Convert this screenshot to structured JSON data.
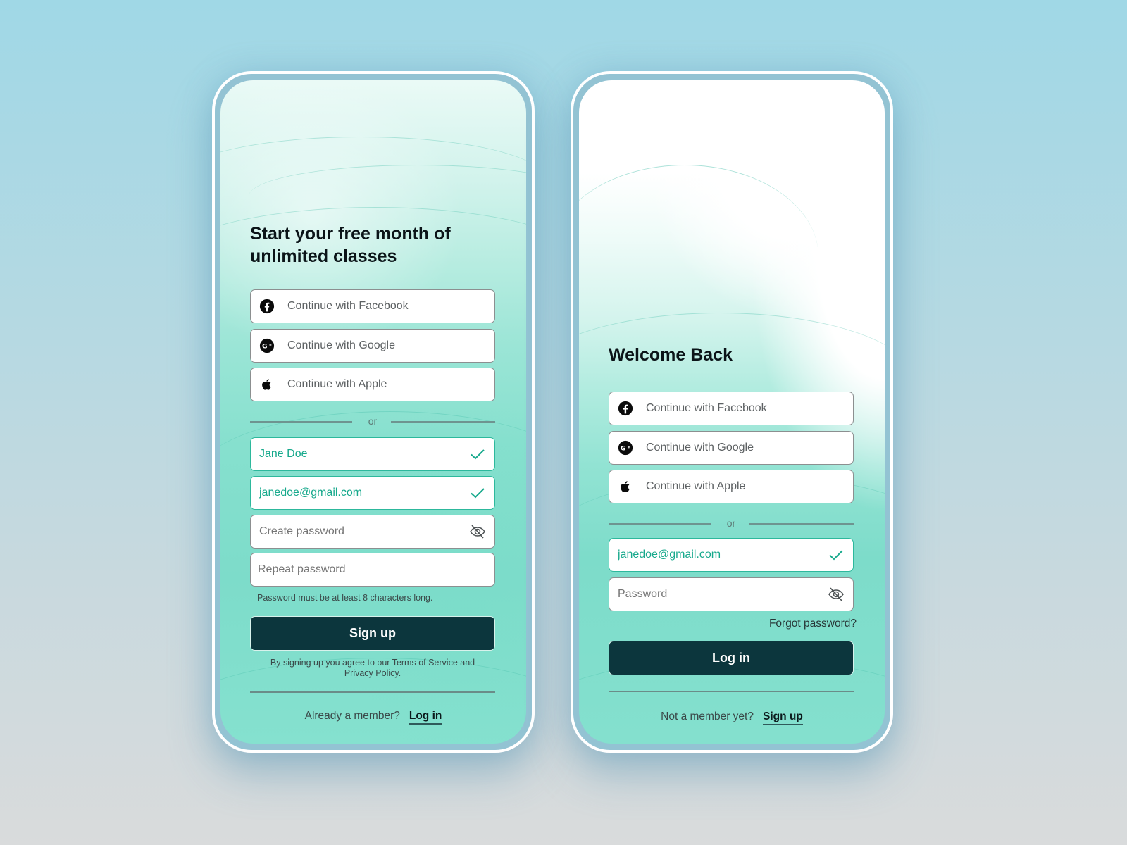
{
  "colors": {
    "accent_teal": "#17a98c",
    "primary_button": "#0c363d",
    "text_dark": "#0b1418",
    "text_muted": "#5d6163"
  },
  "signup": {
    "title_line1": "Start your free month of",
    "title_line2": "unlimited classes",
    "social": [
      {
        "icon": "facebook-icon",
        "label": "Continue with Facebook"
      },
      {
        "icon": "google-plus-icon",
        "label": "Continue with Google"
      },
      {
        "icon": "apple-icon",
        "label": "Continue with Apple"
      }
    ],
    "divider_text": "or",
    "fields": {
      "name": {
        "value": "Jane Doe",
        "status": "valid"
      },
      "email": {
        "value": "janedoe@gmail.com",
        "status": "valid"
      },
      "password": {
        "placeholder": "Create password",
        "trailing_icon": "eye-off-icon"
      },
      "repeat_password": {
        "placeholder": "Repeat password"
      }
    },
    "password_hint": "Password must be at least 8 characters long.",
    "submit_label": "Sign up",
    "terms_line1": "By signing up you agree to our Terms of Service and",
    "terms_line2": "Privacy Policy.",
    "footer_question": "Already a member?",
    "footer_link": "Log in"
  },
  "login": {
    "title": "Welcome Back",
    "social": [
      {
        "icon": "facebook-icon",
        "label": "Continue with Facebook"
      },
      {
        "icon": "google-plus-icon",
        "label": "Continue with Google"
      },
      {
        "icon": "apple-icon",
        "label": "Continue with Apple"
      }
    ],
    "divider_text": "or",
    "fields": {
      "email": {
        "value": "janedoe@gmail.com",
        "status": "valid"
      },
      "password": {
        "placeholder": "Password",
        "trailing_icon": "eye-off-icon"
      }
    },
    "forgot_password": "Forgot password?",
    "submit_label": "Log in",
    "footer_question": "Not a member yet?",
    "footer_link": "Sign up"
  }
}
